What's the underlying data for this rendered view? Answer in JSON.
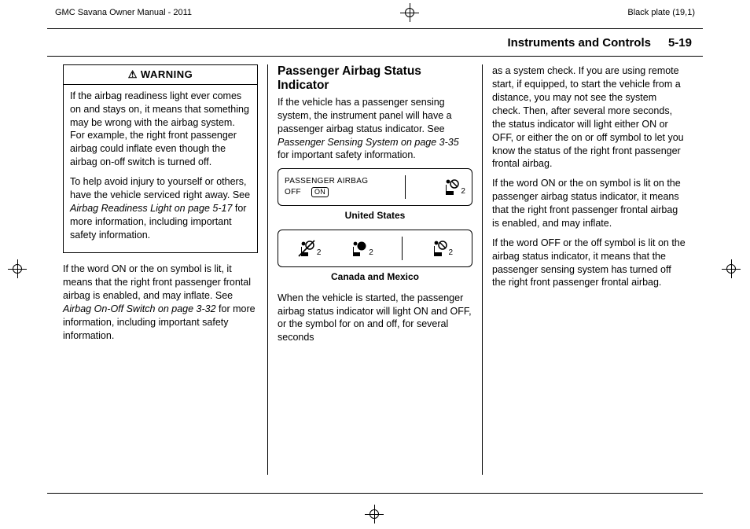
{
  "header": {
    "left": "GMC Savana Owner Manual - 2011",
    "right": "Black plate (19,1)"
  },
  "running_head": {
    "section": "Instruments and Controls",
    "page": "5-19"
  },
  "col1": {
    "warning_label": "WARNING",
    "warn_p1": "If the airbag readiness light ever comes on and stays on, it means that something may be wrong with the airbag system. For example, the right front passenger airbag could inflate even though the airbag on-off switch is turned off.",
    "warn_p2a": "To help avoid injury to yourself or others, have the vehicle serviced right away. See ",
    "warn_p2_ital": "Airbag Readiness Light on page 5‑17",
    "warn_p2b": " for more information, including important safety information.",
    "below_p1a": "If the word ON or the on symbol is lit, it means that the right front passenger frontal airbag is enabled, and may inflate. See ",
    "below_p1_ital": "Airbag On-Off Switch on page 3‑32",
    "below_p1b": " for more information, including important safety information."
  },
  "col2": {
    "title": "Passenger Airbag Status Indicator",
    "p1a": "If the vehicle has a passenger sensing system, the instrument panel will have a passenger airbag status indicator. See ",
    "p1_ital": "Passenger Sensing System on page 3‑35",
    "p1b": " for important safety information.",
    "us_label_line1": "PASSENGER AIRBAG",
    "us_label_line2": "OFF",
    "us_on_pill": "ON",
    "icon_sub": "2",
    "caption_us": "United States",
    "caption_cm": "Canada and Mexico",
    "p2": "When the vehicle is started, the passenger airbag status indicator will light ON and OFF, or the symbol for on and off, for several seconds"
  },
  "col3": {
    "p1": "as a system check. If you are using remote start, if equipped, to start the vehicle from a distance, you may not see the system check. Then, after several more seconds, the status indicator will light either ON or OFF, or either the on or off symbol to let you know the status of the right front passenger frontal airbag.",
    "p2": "If the word ON or the on symbol is lit on the passenger airbag status indicator, it means that the right front passenger frontal airbag is enabled, and may inflate.",
    "p3": "If the word OFF or the off symbol is lit on the airbag status indicator, it means that the passenger sensing system has turned off the right front passenger frontal airbag."
  }
}
